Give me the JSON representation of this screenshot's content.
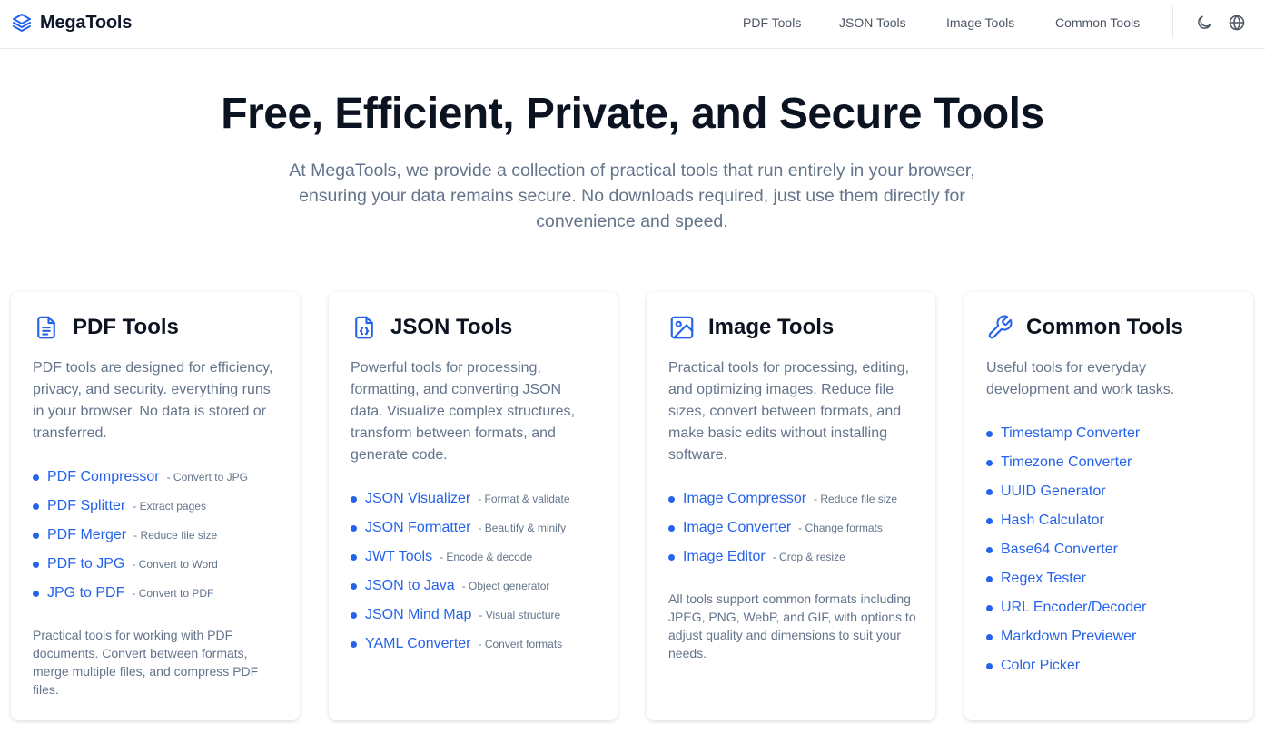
{
  "header": {
    "brand": "MegaTools",
    "nav": [
      "PDF Tools",
      "JSON Tools",
      "Image Tools",
      "Common Tools"
    ]
  },
  "hero": {
    "title": "Free, Efficient, Private, and Secure Tools",
    "subtitle": "At MegaTools, we provide a collection of practical tools that run entirely in your browser, ensuring your data remains secure. No downloads required, just use them directly for convenience and speed."
  },
  "cards": [
    {
      "icon": "document-icon",
      "title": "PDF Tools",
      "description": "PDF tools are designed for efficiency, privacy, and security. everything runs in your browser. No data is stored or transferred.",
      "tools": [
        {
          "name": "PDF Compressor",
          "note": "- Convert to JPG"
        },
        {
          "name": "PDF Splitter",
          "note": "- Extract pages"
        },
        {
          "name": "PDF Merger",
          "note": "- Reduce file size"
        },
        {
          "name": "PDF to JPG",
          "note": "- Convert to Word"
        },
        {
          "name": "JPG to PDF",
          "note": "- Convert to PDF"
        }
      ],
      "footer": "Practical tools for working with PDF documents. Convert between formats, merge multiple files, and compress PDF files."
    },
    {
      "icon": "code-file-icon",
      "title": "JSON Tools",
      "description": "Powerful tools for processing, formatting, and converting JSON data. Visualize complex structures, transform between formats, and generate code.",
      "tools": [
        {
          "name": "JSON Visualizer",
          "note": "- Format & validate"
        },
        {
          "name": "JSON Formatter",
          "note": "- Beautify & minify"
        },
        {
          "name": "JWT Tools",
          "note": "- Encode & decode"
        },
        {
          "name": "JSON to Java",
          "note": "- Object generator"
        },
        {
          "name": "JSON Mind Map",
          "note": "- Visual structure"
        },
        {
          "name": "YAML Converter",
          "note": "- Convert formats"
        }
      ],
      "footer": ""
    },
    {
      "icon": "image-icon",
      "title": "Image Tools",
      "description": "Practical tools for processing, editing, and optimizing images. Reduce file sizes, convert between formats, and make basic edits without installing software.",
      "tools": [
        {
          "name": "Image Compressor",
          "note": "- Reduce file size"
        },
        {
          "name": "Image Converter",
          "note": "- Change formats"
        },
        {
          "name": "Image Editor",
          "note": "- Crop & resize"
        }
      ],
      "footer": "All tools support common formats including JPEG, PNG, WebP, and GIF, with options to adjust quality and dimensions to suit your needs."
    },
    {
      "icon": "wrench-icon",
      "title": "Common Tools",
      "description": "Useful tools for everyday development and work tasks.",
      "tools": [
        {
          "name": "Timestamp Converter",
          "note": ""
        },
        {
          "name": "Timezone Converter",
          "note": ""
        },
        {
          "name": "UUID Generator",
          "note": ""
        },
        {
          "name": "Hash Calculator",
          "note": ""
        },
        {
          "name": "Base64 Converter",
          "note": ""
        },
        {
          "name": "Regex Tester",
          "note": ""
        },
        {
          "name": "URL Encoder/Decoder",
          "note": ""
        },
        {
          "name": "Markdown Previewer",
          "note": ""
        },
        {
          "name": "Color Picker",
          "note": ""
        }
      ],
      "footer": ""
    }
  ],
  "colors": {
    "accent": "#2563eb",
    "heading": "#0b1220",
    "muted": "#64748b"
  }
}
